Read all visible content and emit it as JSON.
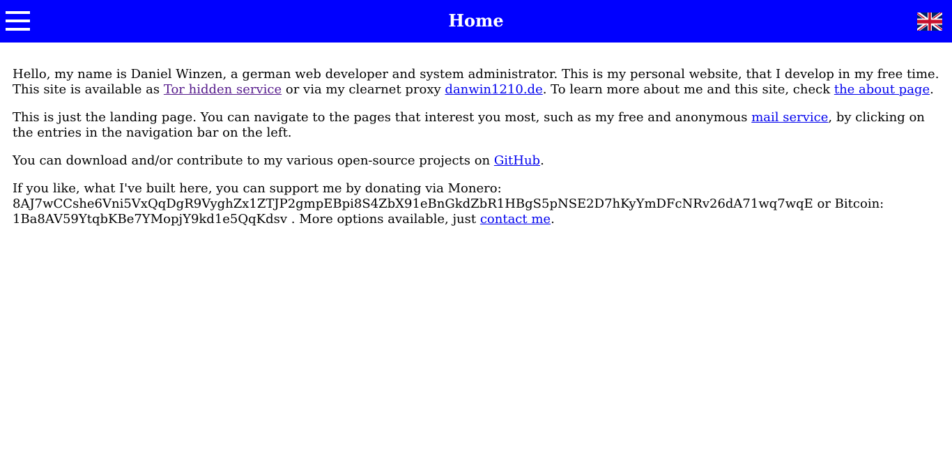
{
  "header": {
    "title": "Home",
    "menu_icon": "hamburger-menu-icon",
    "language_icon": "uk-flag-icon",
    "background_color": "#0000ff",
    "text_color": "#ffffff"
  },
  "content": {
    "p1": {
      "t1": "Hello, my name is Daniel Winzen, a german web developer and system administrator. This is my personal website, that I develop in my free time. This site is available as ",
      "link_tor": "Tor hidden service",
      "t2": " or via my clearnet proxy ",
      "link_clearnet": "danwin1210.de",
      "t3": ". To learn more about me and this site, check ",
      "link_about": "the about page",
      "t4": "."
    },
    "p2": {
      "t1": "This is just the landing page. You can navigate to the pages that interest you most, such as my free and anonymous ",
      "link_mail": "mail service",
      "t2": ", by clicking on the entries in the navigation bar on the left."
    },
    "p3": {
      "t1": "You can download and/or contribute to my various open-source projects on ",
      "link_github": "GitHub",
      "t2": "."
    },
    "p4": {
      "t1": "If you like, what I've built here, you can support me by donating via Monero: ",
      "monero_address": "8AJ7wCCshe6Vni5VxQqDgR9VyghZx1ZTJP2gmpEBpi8S4ZbX91eBnGkdZbR1HBgS5pNSE2D7hKyYmDFcNRv26dA71wq7wqE",
      "t2": " or Bitcoin: ",
      "bitcoin_address": "1Ba8AV59YtqbKBe7YMopjY9kd1e5QqKdsv",
      "t3": " . More options available, just ",
      "link_contact": "contact me",
      "t4": "."
    }
  },
  "colors": {
    "link": "#0000ee",
    "visited_link": "#551a8b"
  }
}
